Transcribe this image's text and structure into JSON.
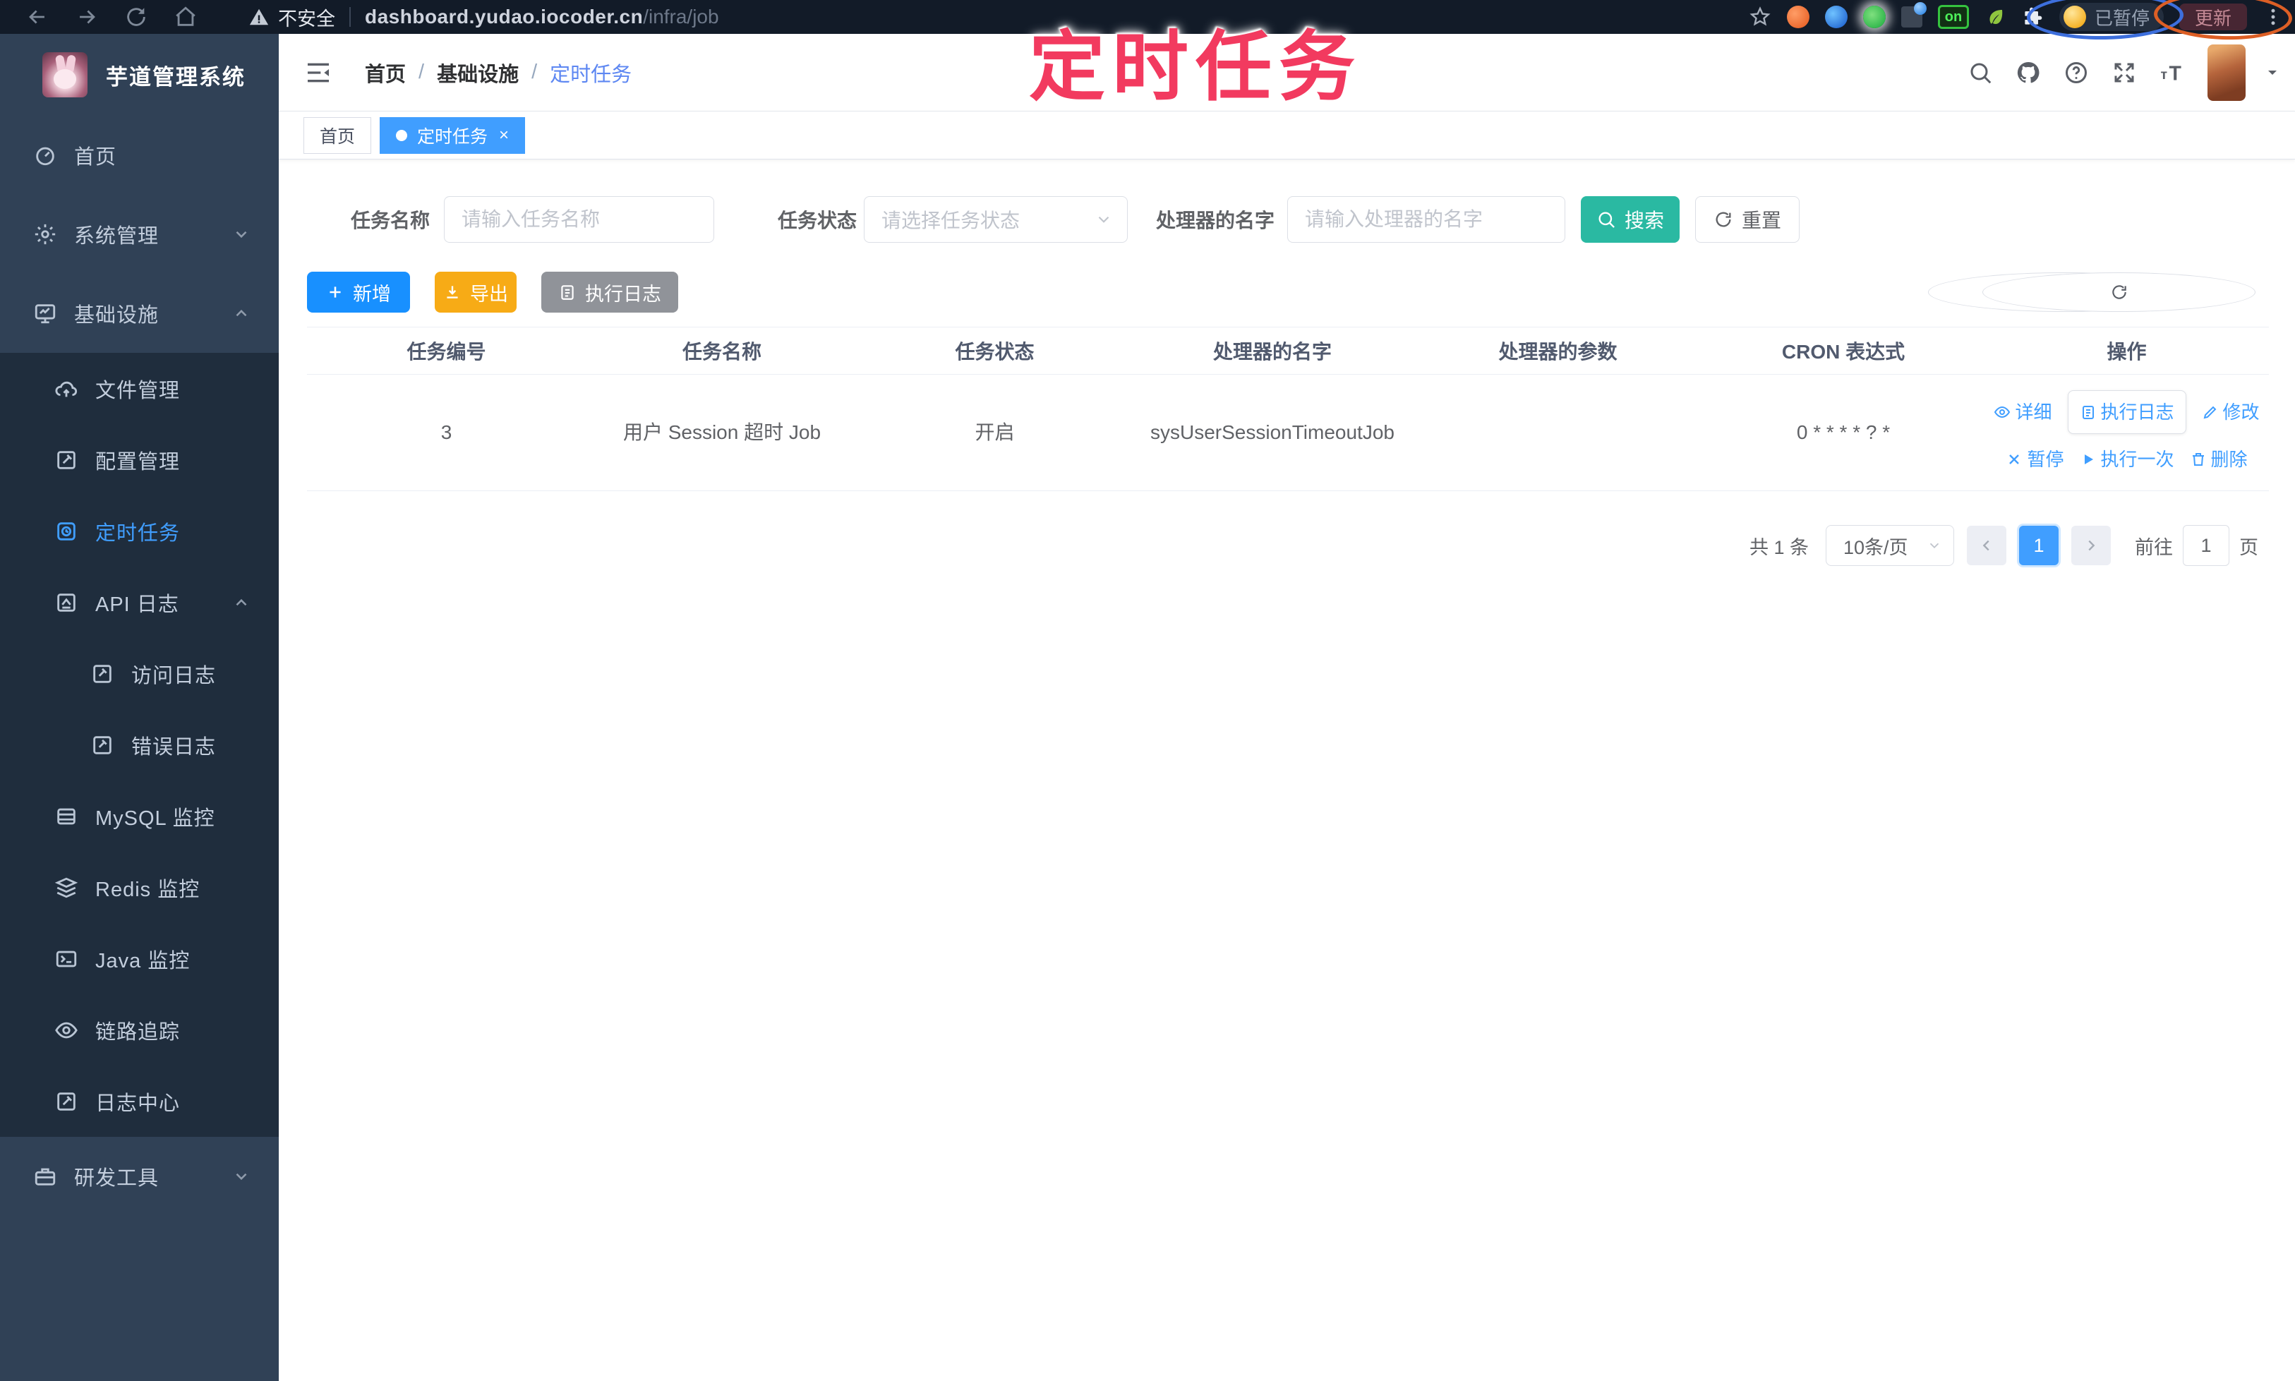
{
  "browser": {
    "insecure_label": "不安全",
    "url_host": "dashboard.yudao.iocoder.cn",
    "url_path": "/infra/job",
    "on_badge": "on",
    "paused_label": "已暂停",
    "update_label": "更新"
  },
  "annotation": {
    "title": "定时任务"
  },
  "sidebar": {
    "app_title": "芋道管理系统",
    "items": [
      {
        "label": "首页"
      },
      {
        "label": "系统管理"
      },
      {
        "label": "基础设施"
      },
      {
        "label": "文件管理"
      },
      {
        "label": "配置管理"
      },
      {
        "label": "定时任务"
      },
      {
        "label": "API 日志"
      },
      {
        "label": "访问日志"
      },
      {
        "label": "错误日志"
      },
      {
        "label": "MySQL 监控"
      },
      {
        "label": "Redis 监控"
      },
      {
        "label": "Java 监控"
      },
      {
        "label": "链路追踪"
      },
      {
        "label": "日志中心"
      },
      {
        "label": "研发工具"
      }
    ]
  },
  "breadcrumb": {
    "items": [
      "首页",
      "基础设施",
      "定时任务"
    ],
    "separator": "/"
  },
  "tabs": [
    {
      "label": "首页"
    },
    {
      "label": "定时任务",
      "close": "×"
    }
  ],
  "filters": {
    "name_label": "任务名称",
    "name_placeholder": "请输入任务名称",
    "status_label": "任务状态",
    "status_placeholder": "请选择任务状态",
    "handler_label": "处理器的名字",
    "handler_placeholder": "请输入处理器的名字",
    "search_label": "搜索",
    "reset_label": "重置"
  },
  "toolbar": {
    "add_label": "新增",
    "export_label": "导出",
    "log_label": "执行日志"
  },
  "table": {
    "headers": [
      "任务编号",
      "任务名称",
      "任务状态",
      "处理器的名字",
      "处理器的参数",
      "CRON 表达式",
      "操作"
    ],
    "rows": [
      {
        "id": "3",
        "name": "用户 Session 超时 Job",
        "status": "开启",
        "handler": "sysUserSessionTimeoutJob",
        "param": "",
        "cron": "0 * * * * ? *"
      }
    ],
    "actions": {
      "detail": "详细",
      "run_log": "执行日志",
      "edit": "修改",
      "pause": "暂停",
      "run_once": "执行一次",
      "delete": "删除"
    }
  },
  "pagination": {
    "total": "共 1 条",
    "page_size": "10条/页",
    "current": "1",
    "goto_label": "前往",
    "goto_value": "1",
    "page_label": "页"
  },
  "colors": {
    "accent": "#409eff",
    "search_button": "#2ab9a2",
    "add_button": "#1890ff",
    "export_button": "#f7ab16",
    "log_button": "#909399",
    "sidebar_bg": "#304156",
    "submenu_bg": "#1f2d3d",
    "annotation": "#f23a5f",
    "browser_bar": "#121b28"
  }
}
